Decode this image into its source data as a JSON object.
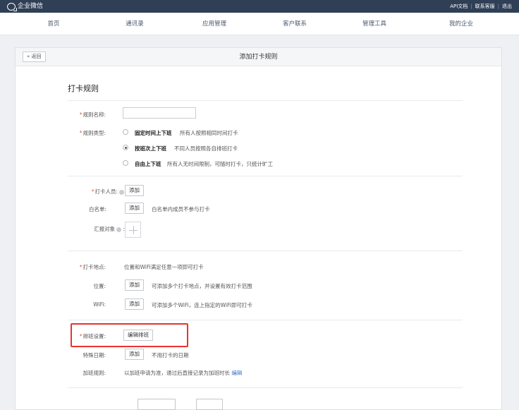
{
  "topbar": {
    "app_title": "企业微信",
    "links": [
      "API文档",
      "联系客服",
      "退出"
    ]
  },
  "nav": {
    "items": [
      "首页",
      "通讯录",
      "应用管理",
      "客户联系",
      "管理工具",
      "我的企业"
    ]
  },
  "panel": {
    "back_label": "« 返回",
    "title": "添加打卡规则"
  },
  "form": {
    "section_title": "打卡规则",
    "rule_name_label": "规则名称:",
    "rule_name_value": "",
    "rule_type_label": "规则类型:",
    "rule_types": [
      {
        "name": "固定时间上下班",
        "desc": "所有人按照相同时间打卡",
        "checked": false
      },
      {
        "name": "按班次上下班",
        "desc": "不同人员按照各自排班打卡",
        "checked": true
      },
      {
        "name": "自由上下班",
        "desc": "所有人无时间限制，可随时打卡，只统计旷工",
        "checked": false
      }
    ],
    "members_label": "打卡人员:",
    "members_button": "添加",
    "whitelist_label": "白名单:",
    "whitelist_button": "添加",
    "whitelist_desc": "白名单内成员不参与打卡",
    "report_label": "汇报对象",
    "location_label": "打卡地点:",
    "location_desc": "位置和WiFi满足任意一项即可打卡",
    "position_label": "位置:",
    "position_button": "添加",
    "position_desc": "可添加多个打卡地点，并设置有效打卡范围",
    "wifi_label": "WiFi:",
    "wifi_button": "添加",
    "wifi_desc": "可添加多个WiFi，连上指定的WiFi即可打卡",
    "schedule_label": "排班设置:",
    "schedule_button": "编辑排班",
    "special_label": "特殊日期:",
    "special_button": "添加",
    "special_desc": "不用打卡的日期",
    "overtime_label": "加班规则:",
    "overtime_desc": "以加班申请为准，通过后直接记录为加班时长",
    "overtime_edit": "编辑"
  },
  "colors": {
    "topbar": "#2f3f56",
    "required": "#e65a42",
    "highlight": "#e8342e",
    "link": "#3670c7"
  }
}
